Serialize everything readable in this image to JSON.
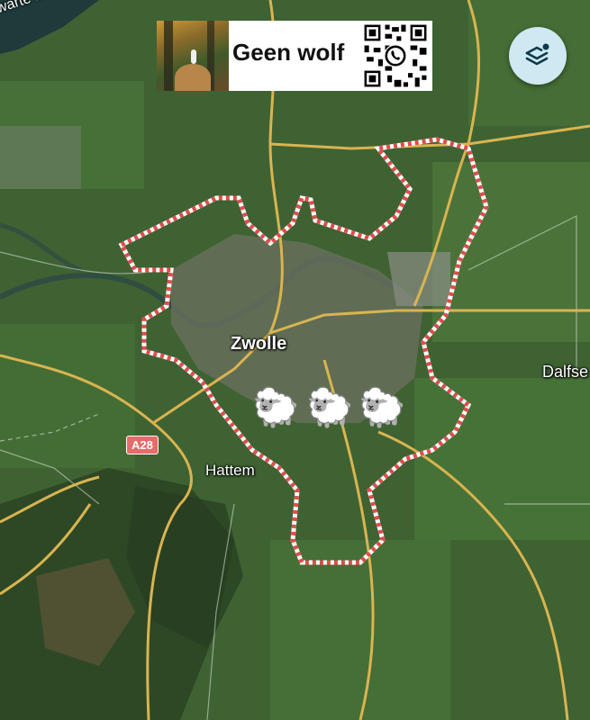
{
  "map": {
    "lake_label": "warte Meer",
    "places": {
      "main_city": "Zwolle",
      "hattem": "Hattem",
      "dalfsen": "Dalfse"
    },
    "road_shield": "A28",
    "boundary_color": "#e34b4b"
  },
  "banner": {
    "text": "Geen wolf",
    "qr_icon": "qr-code-icon",
    "photo": "forest-walker-photo"
  },
  "controls": {
    "layers_icon": "layers-icon",
    "accent": "#cfe8f2"
  },
  "markers": {
    "icon": "sheep-icon",
    "glyph": "🐑",
    "count": 3
  }
}
